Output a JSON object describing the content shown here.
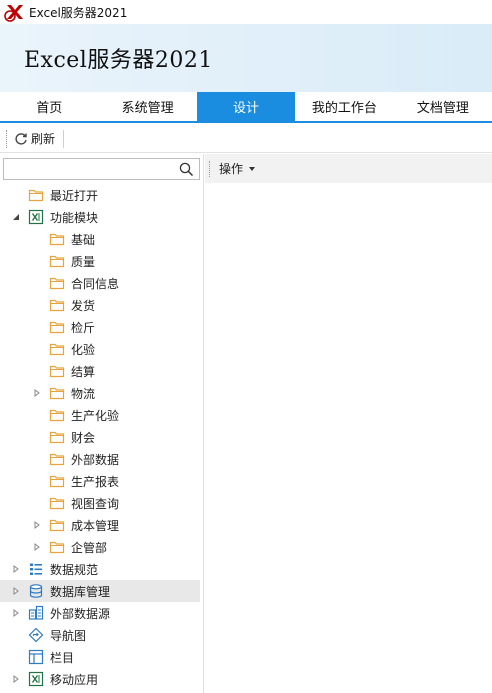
{
  "window": {
    "title": "Excel服务器2021"
  },
  "banner": {
    "title": "Excel服务器2021"
  },
  "tabs": [
    {
      "label": "首页",
      "active": false
    },
    {
      "label": "系统管理",
      "active": false
    },
    {
      "label": "设计",
      "active": true
    },
    {
      "label": "我的工作台",
      "active": false
    },
    {
      "label": "文档管理",
      "active": false
    }
  ],
  "toolbar": {
    "refresh_label": "刷新"
  },
  "search": {
    "value": "",
    "placeholder": ""
  },
  "ops": {
    "label": "操作"
  },
  "tree": [
    {
      "label": "最近打开",
      "icon": "folder-icon",
      "level": 1,
      "expander": "none"
    },
    {
      "label": "功能模块",
      "icon": "excel-icon",
      "level": 1,
      "expander": "expanded"
    },
    {
      "label": "基础",
      "icon": "folder-icon",
      "level": 2,
      "expander": "none"
    },
    {
      "label": "质量",
      "icon": "folder-icon",
      "level": 2,
      "expander": "none"
    },
    {
      "label": "合同信息",
      "icon": "folder-icon",
      "level": 2,
      "expander": "none"
    },
    {
      "label": "发货",
      "icon": "folder-icon",
      "level": 2,
      "expander": "none"
    },
    {
      "label": "检斤",
      "icon": "folder-icon",
      "level": 2,
      "expander": "none"
    },
    {
      "label": "化验",
      "icon": "folder-icon",
      "level": 2,
      "expander": "none"
    },
    {
      "label": "结算",
      "icon": "folder-icon",
      "level": 2,
      "expander": "none"
    },
    {
      "label": "物流",
      "icon": "folder-icon",
      "level": 2,
      "expander": "collapsed"
    },
    {
      "label": "生产化验",
      "icon": "folder-icon",
      "level": 2,
      "expander": "none"
    },
    {
      "label": "财会",
      "icon": "folder-icon",
      "level": 2,
      "expander": "none"
    },
    {
      "label": "外部数据",
      "icon": "folder-icon",
      "level": 2,
      "expander": "none"
    },
    {
      "label": "生产报表",
      "icon": "folder-icon",
      "level": 2,
      "expander": "none"
    },
    {
      "label": "视图查询",
      "icon": "folder-icon",
      "level": 2,
      "expander": "none"
    },
    {
      "label": "成本管理",
      "icon": "folder-icon",
      "level": 2,
      "expander": "collapsed"
    },
    {
      "label": "企管部",
      "icon": "folder-icon",
      "level": 2,
      "expander": "collapsed"
    },
    {
      "label": "数据规范",
      "icon": "data-spec-icon",
      "level": 1,
      "expander": "collapsed"
    },
    {
      "label": "数据库管理",
      "icon": "database-icon",
      "level": 1,
      "expander": "collapsed",
      "selected": true
    },
    {
      "label": "外部数据源",
      "icon": "external-datasource-icon",
      "level": 1,
      "expander": "collapsed"
    },
    {
      "label": "导航图",
      "icon": "navigation-icon",
      "level": 1,
      "expander": "none"
    },
    {
      "label": "栏目",
      "icon": "column-icon",
      "level": 1,
      "expander": "none"
    },
    {
      "label": "移动应用",
      "icon": "mobile-excel-icon",
      "level": 1,
      "expander": "collapsed"
    }
  ],
  "colors": {
    "accent": "#1a8de0",
    "folder": "#e8a33c",
    "excel_green": "#217346",
    "icon_blue": "#2e7bc4"
  }
}
